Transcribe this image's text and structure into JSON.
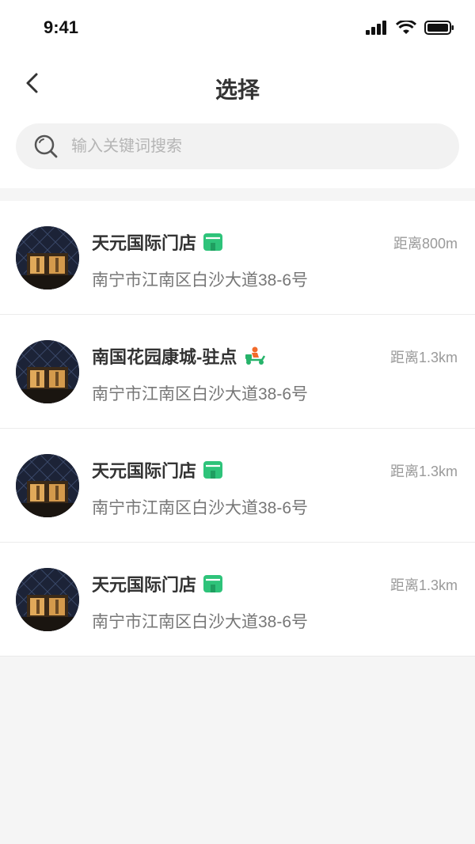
{
  "status": {
    "time": "9:41"
  },
  "nav": {
    "title": "选择"
  },
  "search": {
    "placeholder": "输入关键词搜索"
  },
  "stores": [
    {
      "name": "天元国际门店",
      "type": "store",
      "distance": "距离800m",
      "address": "南宁市江南区白沙大道38-6号"
    },
    {
      "name": "南国花园康城-驻点",
      "type": "delivery",
      "distance": "距离1.3km",
      "address": "南宁市江南区白沙大道38-6号"
    },
    {
      "name": "天元国际门店",
      "type": "store",
      "distance": "距离1.3km",
      "address": "南宁市江南区白沙大道38-6号"
    },
    {
      "name": "天元国际门店",
      "type": "store",
      "distance": "距离1.3km",
      "address": "南宁市江南区白沙大道38-6号"
    }
  ],
  "colors": {
    "store_badge": "#2ec37a",
    "delivery_scooter": "#26b36a",
    "delivery_rider": "#f26b2b"
  }
}
